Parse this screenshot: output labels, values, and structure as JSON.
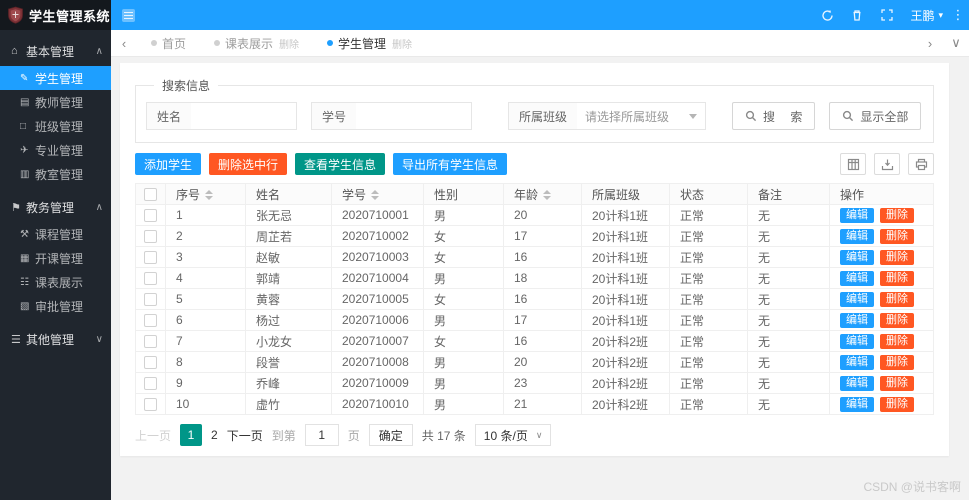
{
  "app": {
    "title": "学生管理系统",
    "watermark": "CSDN @说书客啊"
  },
  "colors": {
    "primary": "#1E9FFF",
    "danger": "#FF5722",
    "success": "#009688",
    "sidebar_bg": "#20262e"
  },
  "icons": {
    "home": "⌂",
    "student": "✎",
    "teacher": "▤",
    "class": "□",
    "major": "✈",
    "room": "▥",
    "academic": "⚑",
    "course": "⚒",
    "schedule": "▦",
    "timetable": "☷",
    "approval": "▧",
    "other": "☰",
    "chevron_up": "∧",
    "chevron_down": "∨",
    "chevron_left": "‹",
    "chevron_right": "›",
    "more": "⋮",
    "caret_down": "▾"
  },
  "header": {
    "user": "王鹏"
  },
  "sidebar": {
    "groups": [
      {
        "label": "基本管理",
        "items": [
          {
            "label": "学生管理"
          },
          {
            "label": "教师管理"
          },
          {
            "label": "班级管理"
          },
          {
            "label": "专业管理"
          },
          {
            "label": "教室管理"
          }
        ]
      },
      {
        "label": "教务管理",
        "items": [
          {
            "label": "课程管理"
          },
          {
            "label": "开课管理"
          },
          {
            "label": "课表展示"
          },
          {
            "label": "审批管理"
          }
        ]
      },
      {
        "label": "其他管理",
        "items": []
      }
    ]
  },
  "tabs": {
    "items": [
      {
        "label": "首页",
        "close": ""
      },
      {
        "label": "课表展示",
        "close": "删除"
      },
      {
        "label": "学生管理",
        "close": "删除"
      }
    ]
  },
  "search": {
    "legend": "搜索信息",
    "name_label": "姓名",
    "sid_label": "学号",
    "class_label": "所属班级",
    "class_placeholder": "请选择所属班级",
    "search_button": "搜 索",
    "show_all_button": "显示全部"
  },
  "toolbar": {
    "add": "添加学生",
    "delete_selected": "删除选中行",
    "view": "查看学生信息",
    "export_all": "导出所有学生信息"
  },
  "table": {
    "columns": [
      "序号",
      "姓名",
      "学号",
      "性别",
      "年龄",
      "所属班级",
      "状态",
      "备注",
      "操作"
    ],
    "edit_label": "编辑",
    "delete_label": "删除",
    "rows": [
      {
        "no": "1",
        "name": "张无忌",
        "sid": "2020710001",
        "sex": "男",
        "age": "20",
        "cls": "20计科1班",
        "status": "正常",
        "note": "无"
      },
      {
        "no": "2",
        "name": "周芷若",
        "sid": "2020710002",
        "sex": "女",
        "age": "17",
        "cls": "20计科1班",
        "status": "正常",
        "note": "无"
      },
      {
        "no": "3",
        "name": "赵敏",
        "sid": "2020710003",
        "sex": "女",
        "age": "16",
        "cls": "20计科1班",
        "status": "正常",
        "note": "无"
      },
      {
        "no": "4",
        "name": "郭靖",
        "sid": "2020710004",
        "sex": "男",
        "age": "18",
        "cls": "20计科1班",
        "status": "正常",
        "note": "无"
      },
      {
        "no": "5",
        "name": "黄蓉",
        "sid": "2020710005",
        "sex": "女",
        "age": "16",
        "cls": "20计科1班",
        "status": "正常",
        "note": "无"
      },
      {
        "no": "6",
        "name": "杨过",
        "sid": "2020710006",
        "sex": "男",
        "age": "17",
        "cls": "20计科1班",
        "status": "正常",
        "note": "无"
      },
      {
        "no": "7",
        "name": "小龙女",
        "sid": "2020710007",
        "sex": "女",
        "age": "16",
        "cls": "20计科2班",
        "status": "正常",
        "note": "无"
      },
      {
        "no": "8",
        "name": "段誉",
        "sid": "2020710008",
        "sex": "男",
        "age": "20",
        "cls": "20计科2班",
        "status": "正常",
        "note": "无"
      },
      {
        "no": "9",
        "name": "乔峰",
        "sid": "2020710009",
        "sex": "男",
        "age": "23",
        "cls": "20计科2班",
        "status": "正常",
        "note": "无"
      },
      {
        "no": "10",
        "name": "虚竹",
        "sid": "2020710010",
        "sex": "男",
        "age": "21",
        "cls": "20计科2班",
        "status": "正常",
        "note": "无"
      }
    ]
  },
  "pagination": {
    "prev": "上一页",
    "page1": "1",
    "page2": "2",
    "next": "下一页",
    "goto_label": "到第",
    "goto_value": "1",
    "page_suffix": "页",
    "confirm": "确定",
    "total": "共 17 条",
    "per_page": "10 条/页"
  }
}
